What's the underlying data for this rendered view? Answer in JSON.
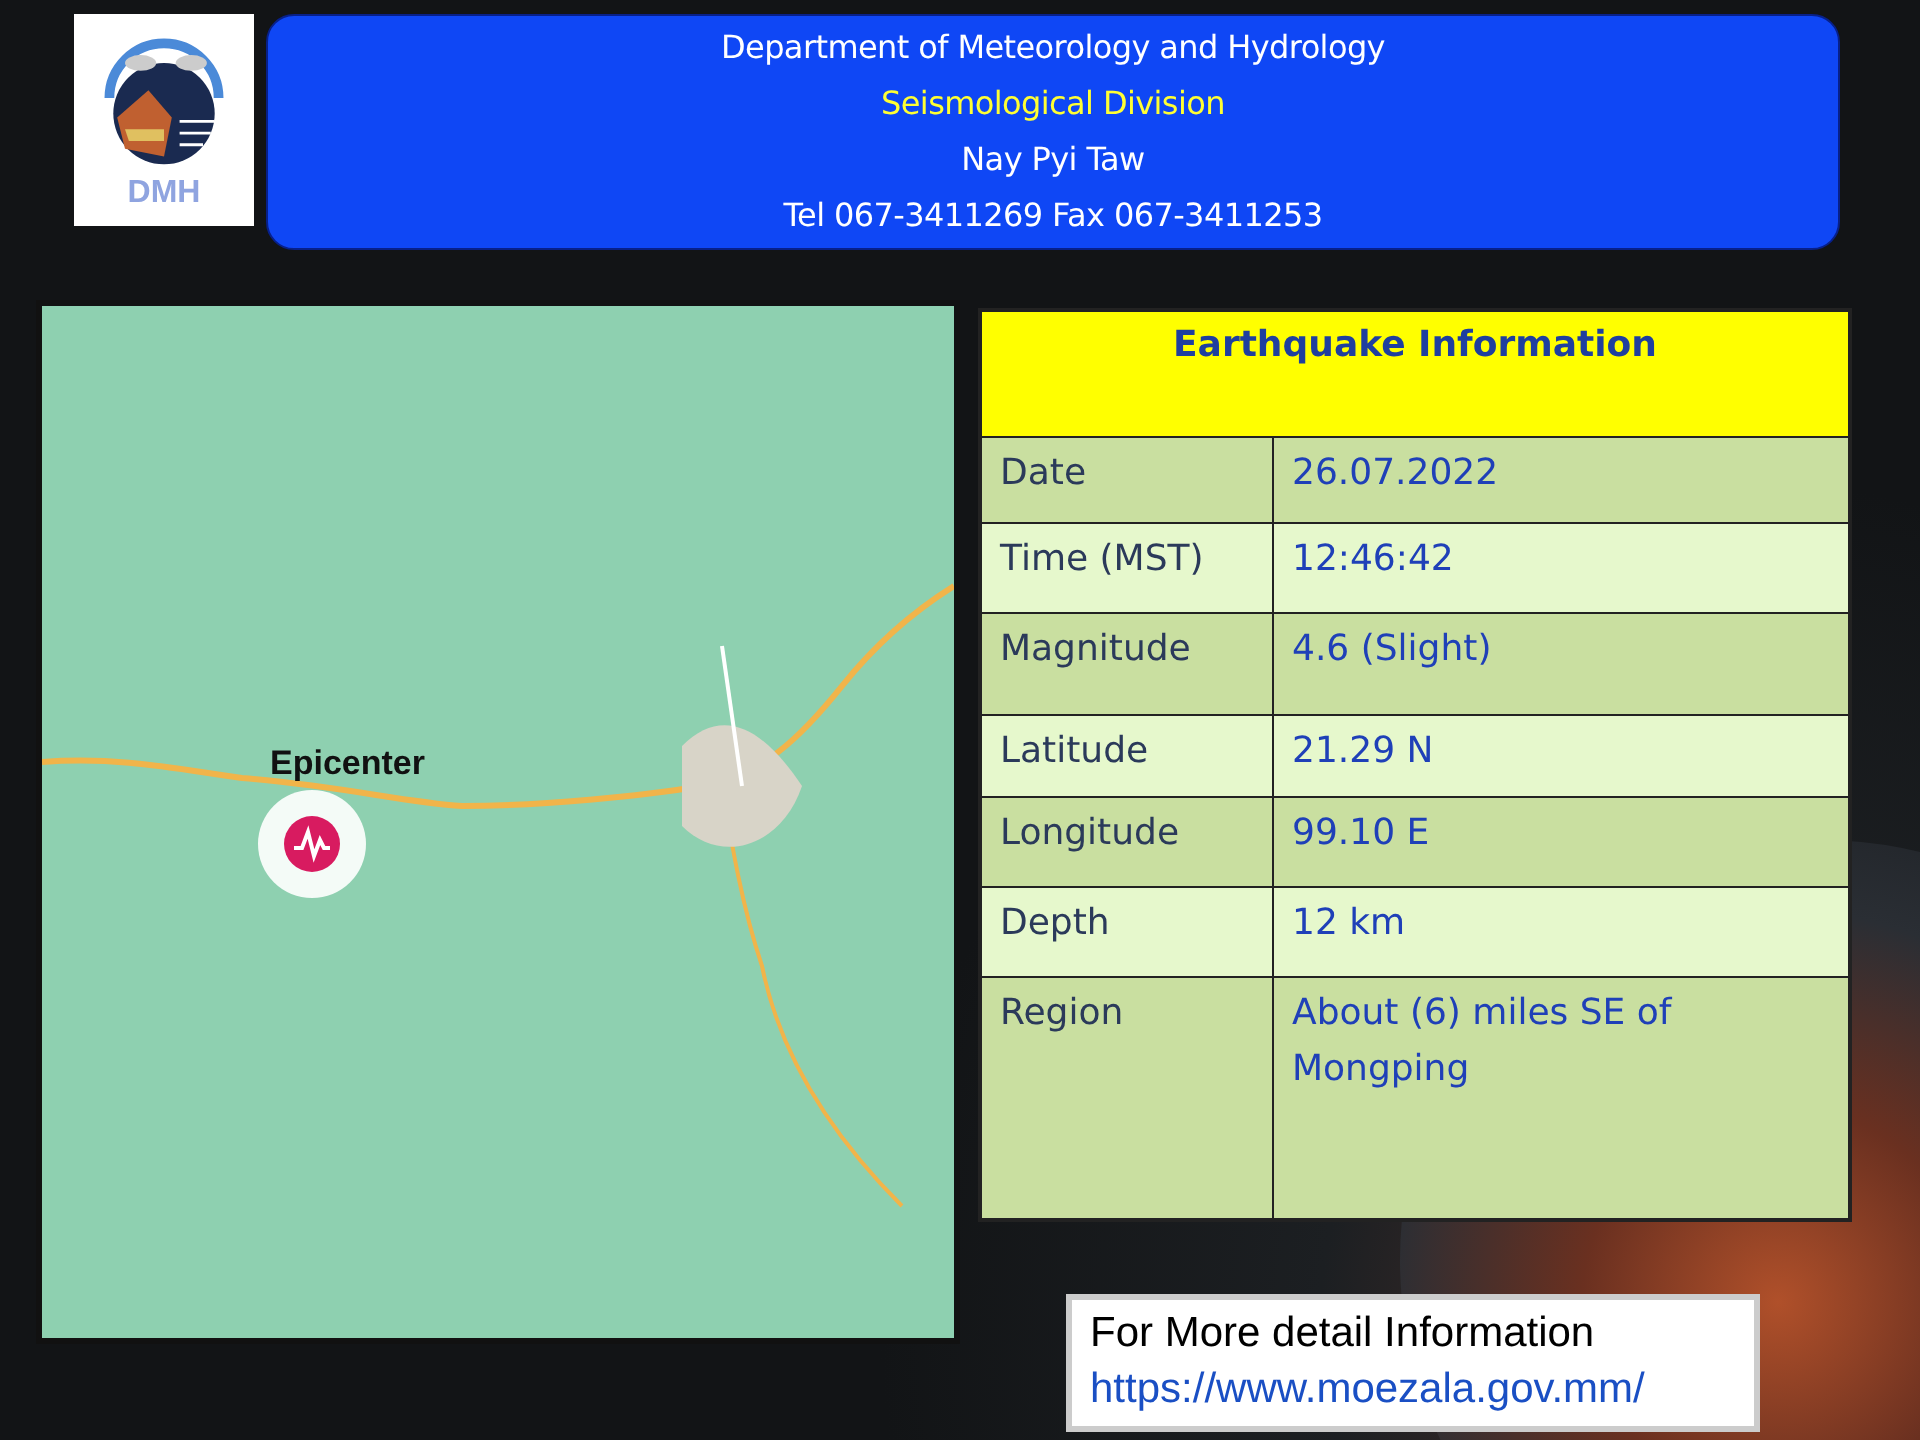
{
  "header": {
    "logo_text": "DMH",
    "lines": [
      {
        "text": "Department of Meteorology and Hydrology",
        "kind": "title"
      },
      {
        "text": "Seismological Division",
        "kind": "highlight"
      },
      {
        "text": "Nay Pyi Taw",
        "kind": "plain"
      },
      {
        "text": "Tel 067-3411269 Fax 067-3411253",
        "kind": "plain"
      }
    ]
  },
  "map": {
    "epicenter_label": "Epicenter"
  },
  "info_table": {
    "title": "Earthquake Information",
    "rows": [
      {
        "label": "Date",
        "value": "26.07.2022"
      },
      {
        "label": "Time (MST)",
        "value": "12:46:42"
      },
      {
        "label": "Magnitude",
        "value": "4.6 (Slight)"
      },
      {
        "label": "Latitude",
        "value": "21.29 N"
      },
      {
        "label": "Longitude",
        "value": "99.10 E"
      },
      {
        "label": "Depth",
        "value": "12 km"
      },
      {
        "label": "Region",
        "value": "About (6) miles SE of Mongping"
      }
    ]
  },
  "more_info": {
    "text": "For More detail Information",
    "link": "https://www.moezala.gov.mm/"
  }
}
